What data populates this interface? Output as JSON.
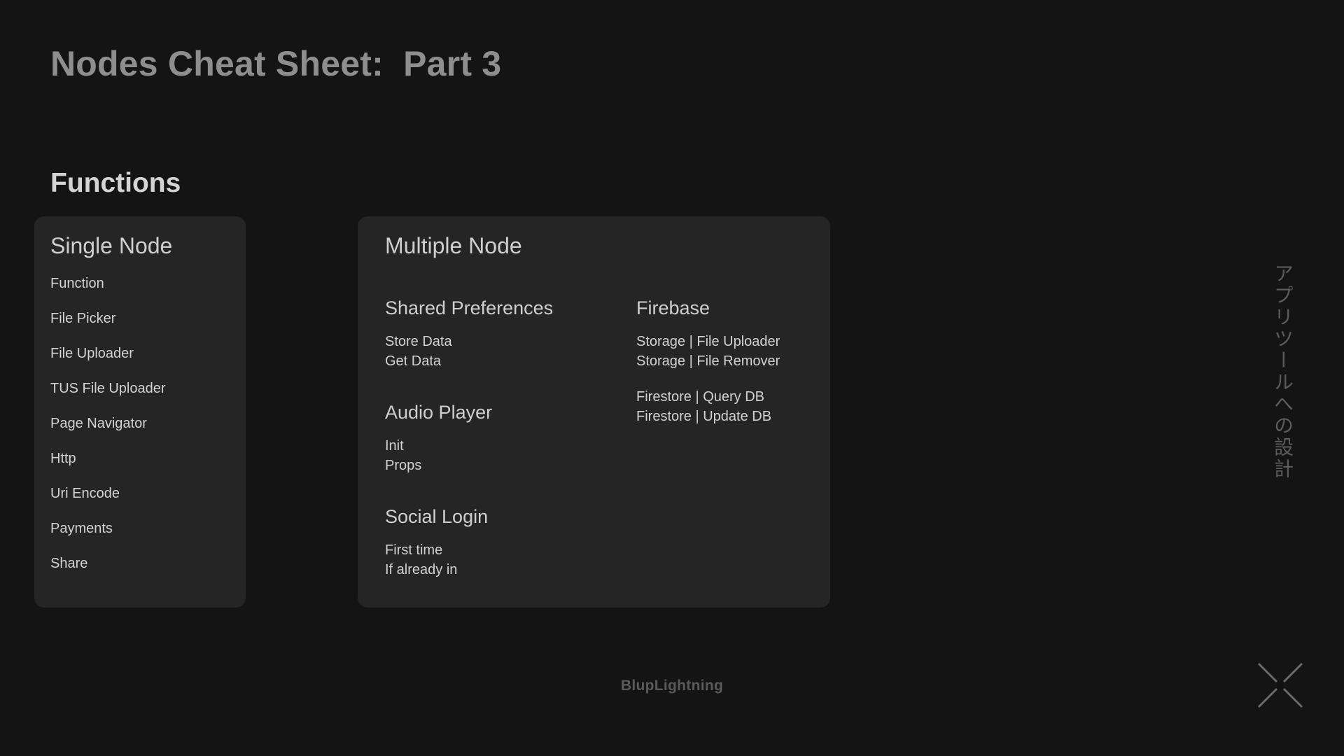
{
  "header": {
    "title": "Nodes Cheat Sheet:  Part 3"
  },
  "section": {
    "title": "Functions"
  },
  "single_node": {
    "title": "Single Node",
    "items": [
      "Function",
      "File Picker",
      "File Uploader",
      "TUS File Uploader",
      "Page Navigator",
      "Http",
      "Uri Encode",
      "Payments",
      "Share"
    ]
  },
  "multiple_node": {
    "title": "Multiple Node",
    "shared_preferences": {
      "title": "Shared Preferences",
      "items": [
        "Store Data",
        "Get Data"
      ]
    },
    "audio_player": {
      "title": "Audio Player",
      "items": [
        "Init",
        "Props"
      ]
    },
    "social_login": {
      "title": "Social Login",
      "items": [
        "First time",
        "If already in"
      ]
    },
    "firebase": {
      "title": "Firebase",
      "storage_items": [
        "Storage | File Uploader",
        "Storage | File Remover"
      ],
      "firestore_items": [
        "Firestore | Query DB",
        "Firestore | Update DB"
      ]
    }
  },
  "side_text": "アプリツールへの設計",
  "footer": {
    "brand": "BlupLightning"
  },
  "icons": {
    "close": "close-icon"
  },
  "colors": {
    "background": "#141414",
    "card": "#252525",
    "title": "#8e8e8e"
  }
}
